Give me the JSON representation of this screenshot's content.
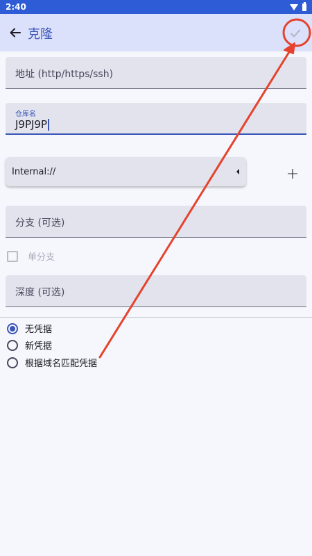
{
  "status_bar": {
    "time": "2:40"
  },
  "app_bar": {
    "title": "克隆",
    "back_icon": "arrow-left-icon",
    "confirm_icon": "check-icon"
  },
  "form": {
    "url_field": {
      "placeholder": "地址 (http/https/ssh)"
    },
    "repo_name_field": {
      "label": "仓库名",
      "value": "J9PJ9P"
    },
    "storage_dropdown": {
      "selected": "Internal://"
    },
    "add_label": "+",
    "branch_field": {
      "placeholder": "分支 (可选)"
    },
    "single_branch_checkbox": {
      "label": "单分支",
      "checked": false
    },
    "depth_field": {
      "placeholder": "深度 (可选)"
    },
    "credentials": {
      "selected_index": 0,
      "options": [
        "无凭据",
        "新凭据",
        "根据域名匹配凭据"
      ]
    }
  },
  "colors": {
    "status_bar": "#2e5cd6",
    "app_bar": "#dce1fb",
    "accent": "#3a55b8",
    "annotation": "#e5432d"
  }
}
